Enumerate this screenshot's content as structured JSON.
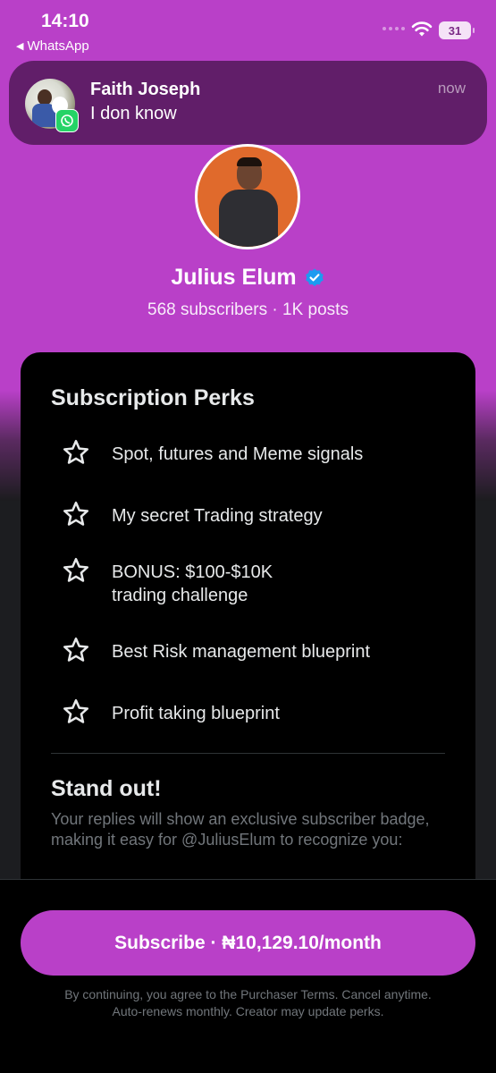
{
  "status_bar": {
    "time": "14:10",
    "back_app": "WhatsApp",
    "battery": "31"
  },
  "notification": {
    "sender": "Faith Joseph",
    "message": "I don know",
    "time": "now",
    "app_icon": "whatsapp-icon"
  },
  "profile": {
    "name": "Julius Elum",
    "verified": true,
    "stats": "568 subscribers · 1K posts"
  },
  "perks": {
    "title": "Subscription Perks",
    "items": [
      {
        "text": "Spot, futures and Meme signals"
      },
      {
        "text": "My secret Trading strategy"
      },
      {
        "line1": "BONUS: $100-$10K",
        "line2": "trading challenge"
      },
      {
        "text": "Best Risk management blueprint"
      },
      {
        "text": "Profit taking blueprint"
      }
    ]
  },
  "standout": {
    "title": "Stand out!",
    "description": "Your replies will show an exclusive subscriber badge, making it easy for @JuliusElum to recognize you:"
  },
  "cta": {
    "label": "Subscribe · ₦10,129.10/month"
  },
  "legal": {
    "line1": "By continuing, you agree to the Purchaser Terms. Cancel anytime.",
    "line2": "Auto-renews monthly. Creator may update perks."
  },
  "colors": {
    "accent": "#b940c8",
    "verified": "#1d9bf0",
    "card": "#000000",
    "muted_text": "#71767b"
  }
}
